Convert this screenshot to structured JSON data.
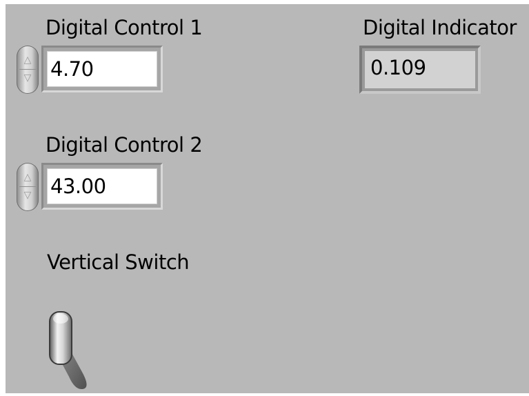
{
  "controls": {
    "digital_control_1": {
      "label": "Digital Control 1",
      "value": "4.70"
    },
    "digital_control_2": {
      "label": "Digital Control 2",
      "value": "43.00"
    }
  },
  "indicators": {
    "digital_indicator": {
      "label": "Digital Indicator",
      "value": "0.109"
    }
  },
  "switch": {
    "label": "Vertical Switch",
    "state": "up"
  },
  "colors": {
    "panel_background": "#b8b8b8",
    "field_background": "#ffffff",
    "indicator_background": "#d2d2d2"
  },
  "icons": {
    "increment": "increment-arrow-icon",
    "decrement": "decrement-arrow-icon"
  }
}
